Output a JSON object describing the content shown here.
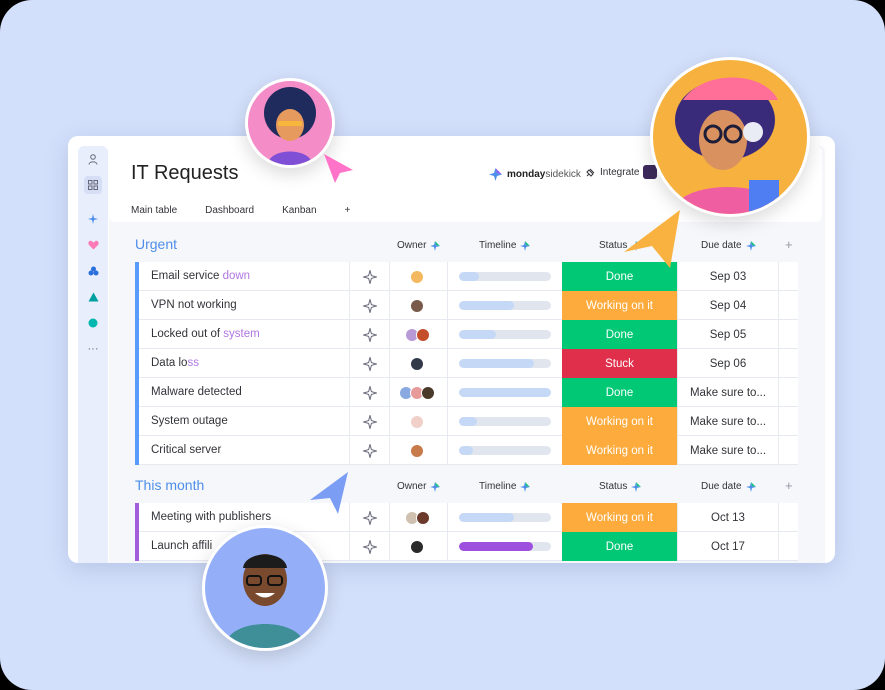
{
  "app": {
    "title": "IT Requests",
    "tabs": [
      "Main table",
      "Dashboard",
      "Kanban",
      "+"
    ],
    "brand_bold": "monday",
    "brand_light": "sidekick",
    "integrate": "Integrate"
  },
  "sidebar": {
    "more": "···"
  },
  "groups": [
    {
      "title": "Urgent",
      "color": "#579bfc",
      "headers": {
        "owner": "Owner",
        "timeline": "Timeline",
        "status": "Status",
        "due": "Due date",
        "add": "+"
      },
      "rows": [
        {
          "name": "Email service ",
          "name_fade": "down",
          "timeline": 0.22,
          "status": "Done",
          "due": "Sep 03"
        },
        {
          "name": "VPN not working",
          "name_fade": "",
          "timeline": 0.6,
          "status": "Working on it",
          "due": "Sep 04"
        },
        {
          "name": "Locked out of ",
          "name_fade": "system",
          "timeline": 0.4,
          "status": "Done",
          "due": "Sep 05"
        },
        {
          "name": "Data lo",
          "name_fade": "ss",
          "timeline": 0.82,
          "status": "Stuck",
          "due": "Sep 06"
        },
        {
          "name": "Malware detected",
          "name_fade": "",
          "timeline": 1.0,
          "status": "Done",
          "due": "Make sure to..."
        },
        {
          "name": "System outage",
          "name_fade": "",
          "timeline": 0.2,
          "status": "Working on it",
          "due": "Make sure to..."
        },
        {
          "name": "Critical server",
          "name_fade": "",
          "timeline": 0.15,
          "status": "Working on it",
          "due": "Make sure to..."
        }
      ]
    },
    {
      "title": "This month",
      "color": "#a25ddc",
      "headers": {
        "owner": "Owner",
        "timeline": "Timeline",
        "status": "Status",
        "due": "Due date",
        "add": "+"
      },
      "rows": [
        {
          "name": "Meeting with publishers",
          "name_fade": "",
          "timeline": 0.6,
          "status": "Working on it",
          "due": "Oct 13"
        },
        {
          "name": "Launch affili",
          "name_fade": "",
          "timeline": 0.8,
          "status": "Done",
          "due": "Oct 17"
        }
      ]
    }
  ],
  "colors": {
    "done": "#00c875",
    "working": "#fdab3d",
    "stuck": "#df2f4a",
    "timeline": "#c5d9f6",
    "timeline_purple": "#9d50dd",
    "background": "#d3e0fb"
  }
}
